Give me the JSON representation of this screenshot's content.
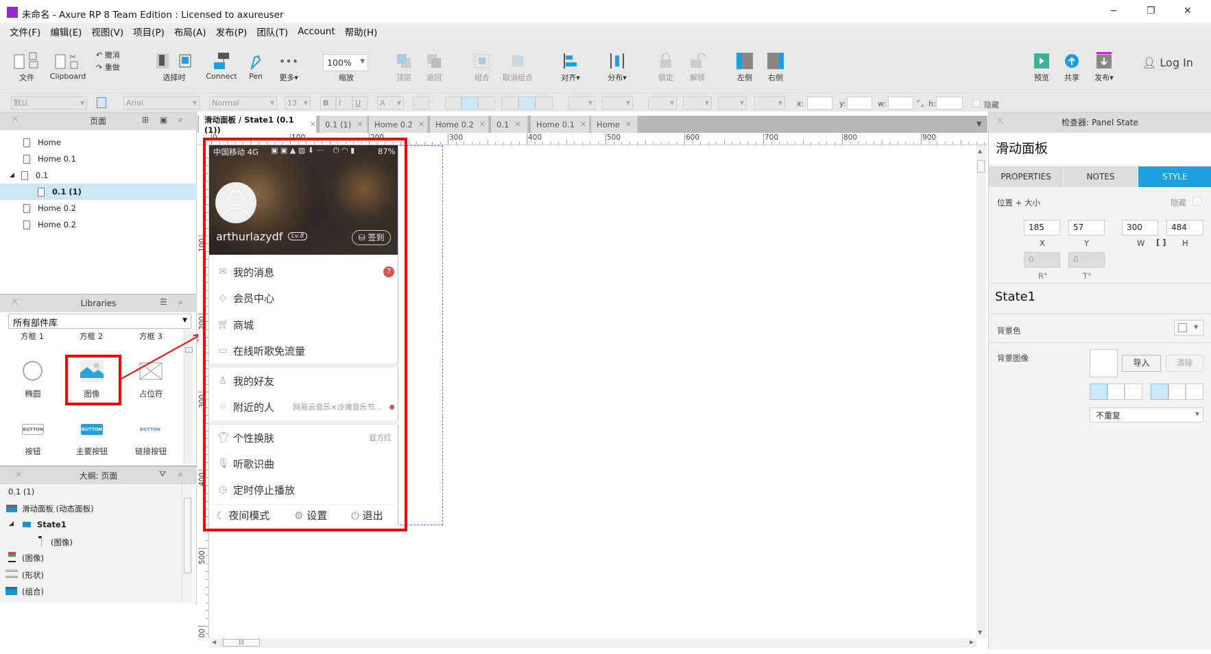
{
  "window": {
    "title": "未命名 - Axure RP 8 Team Edition : Licensed to axureuser",
    "app_icon": "axure-rp-icon",
    "minimize": "−",
    "restore": "❐",
    "close": "✕"
  },
  "menu": [
    "文件(F)",
    "编辑(E)",
    "视图(V)",
    "项目(P)",
    "布局(A)",
    "发布(P)",
    "团队(T)",
    "Account",
    "帮助(H)"
  ],
  "toolbar": {
    "file": "文件",
    "clipboard": "Clipboard",
    "undo": "撤消",
    "redo": "重做",
    "select_mode": "选择时",
    "connect": "Connect",
    "pen": "Pen",
    "more": "更多",
    "zoom_value": "100%",
    "zoom_label": "缩放",
    "bring_front": "顶层",
    "send_back": "返回",
    "group": "组合",
    "ungroup": "取消组合",
    "align": "对齐",
    "distribute": "分布",
    "lock": "锁定",
    "unlock": "解锁",
    "left": "左侧",
    "right": "右侧",
    "preview": "预览",
    "share": "共享",
    "publish": "发布",
    "login": "Log In"
  },
  "format": {
    "style": "默认",
    "font": "Arial",
    "weight": "Normal",
    "size": "13",
    "bold": "B",
    "italic": "I",
    "underline": "U",
    "font_color": "A",
    "x_label": "x:",
    "y_label": "y:",
    "w_label": "w:",
    "h_label": "h:",
    "hidden_label": "隐藏"
  },
  "pages": {
    "title": "页面",
    "items": [
      {
        "label": "Home"
      },
      {
        "label": "Home 0.1"
      },
      {
        "label": "0.1",
        "expanded": true
      },
      {
        "label": "0.1 (1)",
        "selected": true
      },
      {
        "label": "Home 0.2"
      },
      {
        "label": "Home 0.2"
      }
    ]
  },
  "libraries": {
    "title": "Libraries",
    "selected": "所有部件库",
    "partial_row": [
      "方框 1",
      "方框 2",
      "方框 3"
    ],
    "widgets": [
      {
        "label": "椭圆"
      },
      {
        "label": "图像",
        "highlighted": true
      },
      {
        "label": "占位符"
      },
      {
        "label": "按钮"
      },
      {
        "label": "主要按钮"
      },
      {
        "label": "链接按钮"
      }
    ],
    "button_text": "BUTTON"
  },
  "outline": {
    "title": "大纲: 页面",
    "items": [
      "0.1 (1)",
      "滑动面板 (动态面板)",
      "State1",
      "(图像)",
      "(图像)",
      "(形状)",
      "(组合)"
    ]
  },
  "tabs": [
    {
      "label": "滑动面板 / State1 (0.1 (1))",
      "active": true
    },
    {
      "label": "0.1 (1)"
    },
    {
      "label": "Home 0.2"
    },
    {
      "label": "Home 0.2"
    },
    {
      "label": "0.1"
    },
    {
      "label": "Home 0.1"
    },
    {
      "label": "Home"
    }
  ],
  "tab_close": "✕",
  "ruler": {
    "h": [
      "0",
      "100",
      "200",
      "300",
      "400",
      "500",
      "600",
      "700",
      "800",
      "900"
    ],
    "v": [
      "100",
      "200",
      "300",
      "400",
      "500",
      "600"
    ]
  },
  "phone": {
    "carrier": "中国移动 4G",
    "battery": "87%",
    "username": "arthurlazydf",
    "level": "Lv.8",
    "checkin": "签到",
    "menu": [
      {
        "label": "我的消息",
        "icon": "mail-icon",
        "badge": "7"
      },
      {
        "label": "会员中心",
        "icon": "diamond-icon"
      },
      {
        "label": "商城",
        "icon": "cart-icon"
      },
      {
        "label": "在线听歌免流量",
        "icon": "sim-icon"
      },
      {
        "label": "我的好友",
        "icon": "person-icon"
      },
      {
        "label": "附近的人",
        "icon": "location-icon",
        "note": "网易云音乐×沙滩音乐节..."
      },
      {
        "label": "个性换肤",
        "icon": "shirt-icon",
        "note": "官方红"
      },
      {
        "label": "听歌识曲",
        "icon": "mic-icon"
      },
      {
        "label": "定时停止播放",
        "icon": "clock-icon"
      }
    ],
    "bottom": [
      {
        "label": "夜间模式",
        "icon": "moon-icon"
      },
      {
        "label": "设置",
        "icon": "gear-icon"
      },
      {
        "label": "退出",
        "icon": "power-icon"
      }
    ]
  },
  "inspector": {
    "header": "检查器: Panel State",
    "title": "滑动面板",
    "tabs": [
      "PROPERTIES",
      "NOTES",
      "STYLE"
    ],
    "active_tab": "STYLE",
    "section": "位置 + 大小",
    "hidden": "隐藏",
    "x": "185",
    "y": "57",
    "w": "300",
    "h": "484",
    "r": "0",
    "t": "0",
    "x_label": "X",
    "y_label": "Y",
    "w_label": "W",
    "h_label": "H",
    "r_label": "R°",
    "t_label": "T°",
    "state": "State1",
    "bg_color": "背景色",
    "bg_image": "背景图像",
    "import": "导入",
    "clear": "清除",
    "repeat": "不重复"
  },
  "colors": {
    "accent": "#1ea0e0",
    "annotation": "#ff0000",
    "selection": "#cde8f7",
    "badge": "#e05050"
  }
}
